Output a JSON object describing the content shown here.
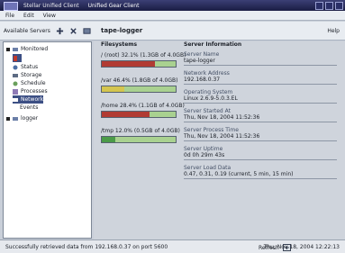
{
  "window": {
    "app_name": "Stellar Unified Client",
    "title": "Unified Gear Client",
    "controls_label": "?"
  },
  "menubar": {
    "items": [
      "File",
      "Edit",
      "View"
    ]
  },
  "toolbar": {
    "left_label": "Available Servers",
    "node_title": "tape-logger",
    "help": "Help"
  },
  "sidebar": {
    "items": [
      {
        "label": "Monitored",
        "level": 0,
        "expanded": true,
        "selected": false
      },
      {
        "label": "",
        "level": 1,
        "expanded": false,
        "selected": true
      },
      {
        "label": "Status",
        "level": 1,
        "expanded": false,
        "selected": false
      },
      {
        "label": "Storage",
        "level": 1,
        "expanded": false,
        "selected": false
      },
      {
        "label": "Schedule",
        "level": 1,
        "expanded": false,
        "selected": false
      },
      {
        "label": "Processes",
        "level": 1,
        "expanded": false,
        "selected": false
      },
      {
        "label": "Network",
        "level": 1,
        "expanded": false,
        "selected": false
      },
      {
        "label": "Events",
        "level": 1,
        "expanded": false,
        "selected": false
      },
      {
        "label": "logger",
        "level": 0,
        "expanded": false,
        "selected": false
      }
    ]
  },
  "main": {
    "left_heading": "Filesystems",
    "right_heading": "Server Information",
    "filesystems": [
      {
        "label": "/ (root) 32.1% (1.3GB of 4.0GB)",
        "used_fraction": 0.72,
        "used_color": "#b13b33"
      },
      {
        "label": "/var  46.4% (1.8GB of 4.0GB)",
        "used_fraction": 0.3,
        "used_color": "#d4c54f"
      },
      {
        "label": "/home  28.4% (1.1GB of 4.0GB)",
        "used_fraction": 0.65,
        "used_color": "#b13b33"
      },
      {
        "label": "/tmp  12.0% (0.5GB of 4.0GB)",
        "used_fraction": 0.18,
        "used_color": "#4b9b48"
      }
    ],
    "info": [
      {
        "label": "Server Name",
        "value": "tape-logger"
      },
      {
        "label": "Network Address",
        "value": "192.168.0.37"
      },
      {
        "label": "Operating System",
        "value": "Linux 2.6.9-5.0.3.EL"
      },
      {
        "label": "Server Started At",
        "value": "Thu, Nov 18, 2004 11:52:36"
      },
      {
        "label": "Server Process Time",
        "value": "Thu, Nov 18, 2004 11:52:36"
      },
      {
        "label": "Server Uptime",
        "value": "0d 0h 29m 43s"
      },
      {
        "label": "Server Load Data",
        "value": "0.47, 0.31, 0.19 (current, 5 min, 15 min)"
      }
    ]
  },
  "statusbar": {
    "message": "Successfully retrieved data from 192.168.0.37 on port 5600",
    "refresh_label": "Refresh",
    "timestamp": "Thu, Nov 18, 2004 12:22:13"
  },
  "colors": {
    "title_bg": "#1a1d44",
    "selected_bg": "#3c4f84",
    "free_space": "#a9d190"
  }
}
